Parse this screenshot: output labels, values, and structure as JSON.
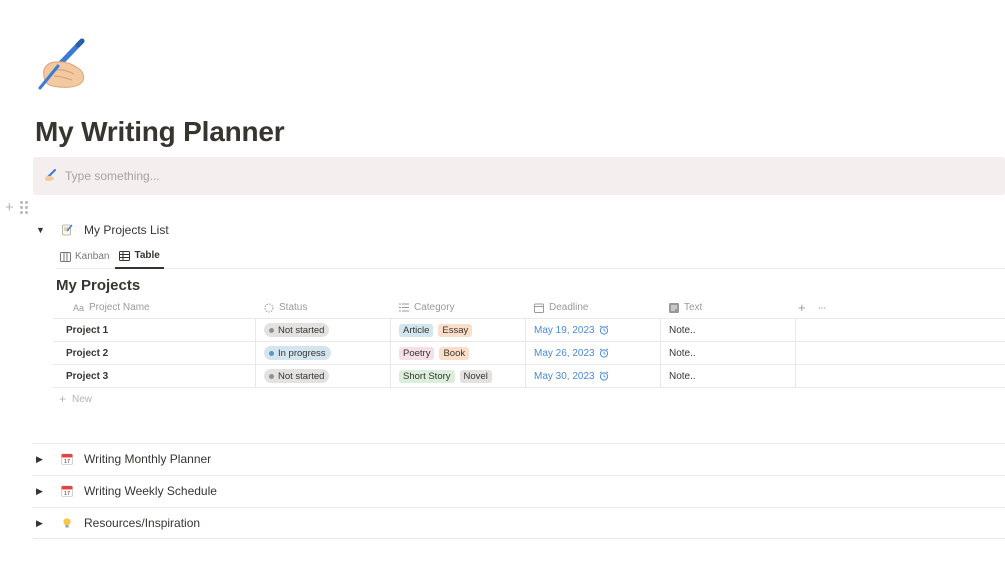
{
  "page": {
    "icon": "writing-hand-icon",
    "title": "My Writing Planner"
  },
  "callout": {
    "icon": "pen-icon",
    "placeholder": "Type something..."
  },
  "sections": [
    {
      "icon": "memo-icon",
      "label": "My Projects List",
      "expanded": true
    },
    {
      "icon": "calendar-icon",
      "label": "Writing Monthly Planner",
      "expanded": false
    },
    {
      "icon": "calendar-icon",
      "label": "Writing Weekly Schedule",
      "expanded": false
    },
    {
      "icon": "lightbulb-icon",
      "label": "Resources/Inspiration",
      "expanded": false
    }
  ],
  "views": [
    {
      "label": "Kanban",
      "icon": "board-icon",
      "active": false
    },
    {
      "label": "Table",
      "icon": "table-icon",
      "active": true
    }
  ],
  "database": {
    "title": "My Projects",
    "columns": [
      {
        "label": "Project Name",
        "icon": "Aa"
      },
      {
        "label": "Status",
        "icon": "status-icon"
      },
      {
        "label": "Category",
        "icon": "list-icon"
      },
      {
        "label": "Deadline",
        "icon": "calendar-icon"
      },
      {
        "label": "Text",
        "icon": "text-icon"
      }
    ],
    "rows": [
      {
        "name": "Project 1",
        "status": "Not started",
        "categories": [
          "Article",
          "Essay"
        ],
        "deadline": "May 19, 2023",
        "text": "Note.."
      },
      {
        "name": "Project 2",
        "status": "In progress",
        "categories": [
          "Poetry",
          "Book"
        ],
        "deadline": "May 26, 2023",
        "text": "Note.."
      },
      {
        "name": "Project 3",
        "status": "Not started",
        "categories": [
          "Short Story",
          "Novel"
        ],
        "deadline": "May 30, 2023",
        "text": "Note.."
      }
    ],
    "new_label": "New",
    "add_column": "+",
    "more": "···"
  },
  "colors": {
    "status": {
      "Not started": {
        "bg": "#e3e2e0",
        "dot": "#91918e"
      },
      "In progress": {
        "bg": "#d3e5ef",
        "dot": "#5b97bd"
      }
    },
    "tags": {
      "Article": "#d3e5ef",
      "Essay": "#fadec9",
      "Poetry": "#f5e0e9",
      "Book": "#fadec9",
      "Short Story": "#dbeddb",
      "Novel": "#e3e2e0"
    },
    "callout_bg": "#f4eeee",
    "date": "#4b8ad6"
  }
}
